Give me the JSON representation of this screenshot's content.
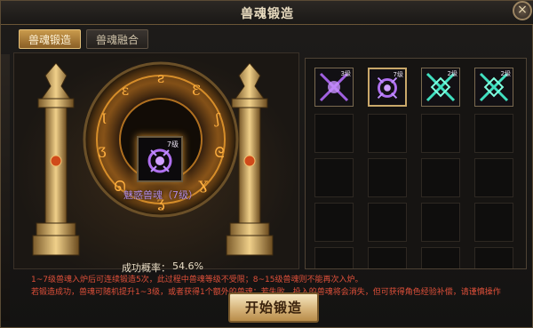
{
  "window": {
    "title": "兽魂锻造",
    "close_icon": "×"
  },
  "tabs": [
    {
      "label": "兽魂锻造",
      "active": true
    },
    {
      "label": "兽魂融合",
      "active": false
    }
  ],
  "forge": {
    "item_name": "魅惑兽魂（7级）",
    "item_level": "7级",
    "success_rate_label": "成功概率：",
    "success_rate_value": "54.6%",
    "note_line1": "1~7级兽魂入炉后可连续锻造5次，此过程中兽魂等级不受限；8~15级兽魂则不能再次入炉。",
    "note_line2": "若锻造成功，兽魂可随机提升1~3级，或者获得1个额外的兽魂；若失败，投入的兽魂将会消失，但可获得角色经验补偿，请谨慎操作",
    "start_button": "开始锻造"
  },
  "inventory": {
    "slots": [
      {
        "level": "3级",
        "color": "#a060e0"
      },
      {
        "level": "7级",
        "color": "#b070f0"
      },
      {
        "level": "2级",
        "color": "#40e0c0"
      },
      {
        "level": "2级",
        "color": "#40e0c0"
      }
    ]
  },
  "colors": {
    "accent_gold": "#d6b47a",
    "warning_red": "#e0503a",
    "rune_orange": "#f0a030"
  }
}
